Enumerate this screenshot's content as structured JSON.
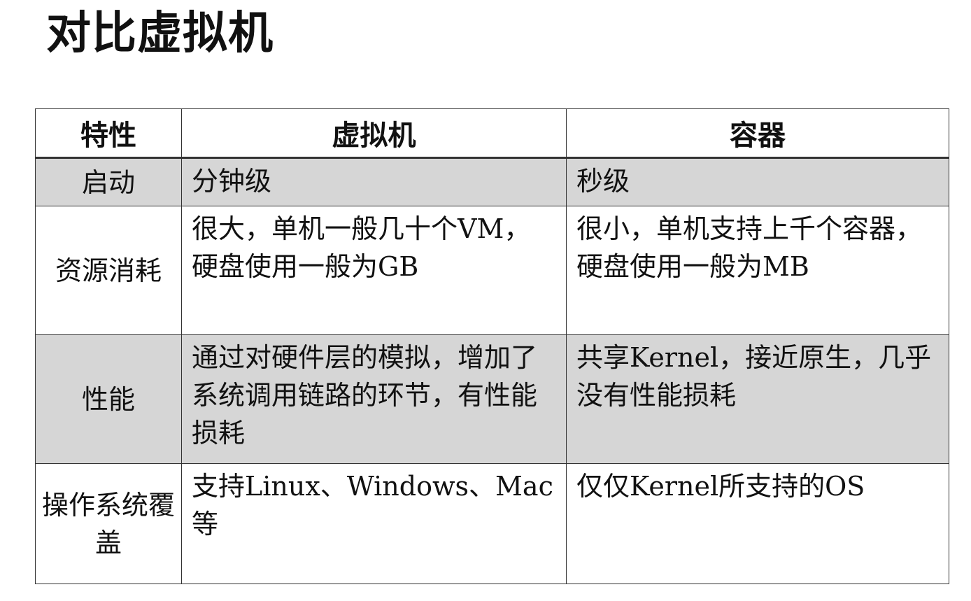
{
  "slide": {
    "title": "对比虚拟机"
  },
  "table": {
    "headers": [
      "特性",
      "虚拟机",
      "容器"
    ],
    "rows": [
      {
        "feature": "启动",
        "vm": "分钟级",
        "container": "秒级",
        "shaded": true
      },
      {
        "feature": "资源消耗",
        "vm": "很大，单机一般几十个VM，硬盘使用一般为GB",
        "container": "很小，单机支持上千个容器，硬盘使用一般为MB",
        "shaded": false
      },
      {
        "feature": "性能",
        "vm": "通过对硬件层的模拟，增加了系统调用链路的环节，有性能损耗",
        "container": "共享Kernel，接近原生，几乎没有性能损耗",
        "shaded": true
      },
      {
        "feature": "操作系统覆盖",
        "vm": "支持Linux、Windows、Mac等",
        "container": "仅仅Kernel所支持的OS",
        "shaded": false
      }
    ]
  },
  "colors": {
    "shaded_row": "#d6d6d6",
    "border": "#333333",
    "text": "#111111"
  }
}
